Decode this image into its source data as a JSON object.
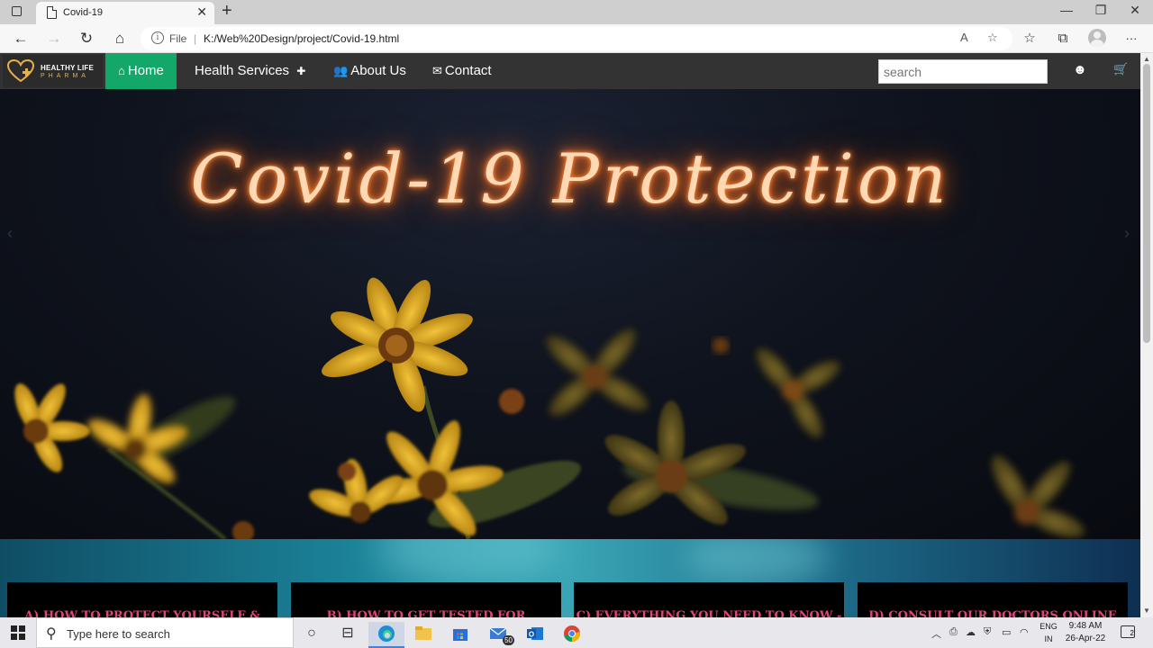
{
  "browser": {
    "tab_title": "Covid-19",
    "tab_close": "✕",
    "new_tab": "+",
    "window_controls": {
      "minimize": "—",
      "maximize": "❐",
      "close": "✕"
    },
    "toolbar": {
      "back": "←",
      "forward": "→",
      "refresh": "↻",
      "home": "⌂",
      "address_info": "i",
      "address_scheme": "File",
      "address_sep": "|",
      "address_url": "K:/Web%20Design/project/Covid-19.html",
      "read_aloud": "A",
      "favorite": "☆",
      "favorites": "☆",
      "collections": "⧉",
      "more": "···"
    }
  },
  "site": {
    "logo": {
      "line1": "HEALTHY LIFE",
      "line2": "PHARMA"
    },
    "nav": [
      {
        "icon": "⌂",
        "label": "Home",
        "active": true
      },
      {
        "icon": "",
        "label": "Health Services",
        "suffix_icon": "✚"
      },
      {
        "icon": "👥",
        "label": "About Us"
      },
      {
        "icon": "✉",
        "label": "Contact"
      }
    ],
    "search_placeholder": "search",
    "account_icon": "☻",
    "cart_icon": "🛒",
    "hero": {
      "title": "Covid-19 Protection",
      "prev_arrow": "‹",
      "next_arrow": "›"
    },
    "cards": [
      "A) HOW TO PROTECT YOURSELF &",
      "B) HOW TO GET TESTED FOR",
      "C) EVERYTHING YOU NEED TO KNOW -",
      "D) CONSULT OUR DOCTORS ONLINE"
    ]
  },
  "taskbar": {
    "search_placeholder": "Type here to search",
    "mail_badge": "50",
    "language": {
      "line1": "ENG",
      "line2": "IN"
    },
    "clock": {
      "time": "9:48 AM",
      "date": "26-Apr-22"
    },
    "notification_count": "2"
  },
  "colors": {
    "nav_bg": "#333333",
    "nav_active": "#13a86a",
    "neon": "#ff8a3d",
    "card_text": "#e0447a"
  }
}
